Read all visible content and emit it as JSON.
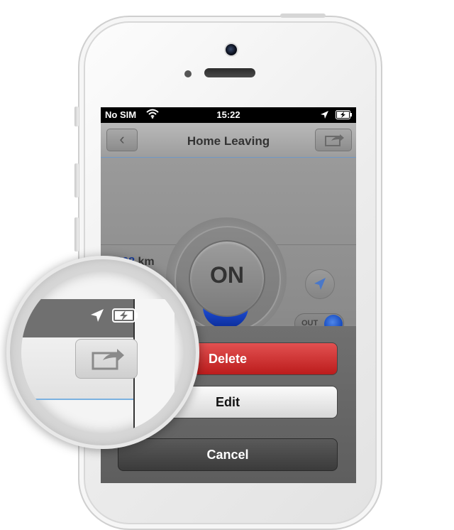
{
  "status_bar": {
    "carrier": "No SIM",
    "time": "15:22",
    "wifi_icon": "wifi-icon",
    "location_icon": "location-arrow-icon",
    "battery_icon": "battery-charging-icon"
  },
  "nav": {
    "title": "Home Leaving",
    "back_icon": "chevron-left-icon",
    "share_icon": "share-icon"
  },
  "main": {
    "distance_value": "7 508",
    "distance_unit": "km",
    "dial_label": "ON",
    "dial_level": 0.2,
    "navigate_icon": "navigation-arrow-icon",
    "toggle_label": "OUT",
    "toggle_state": "on"
  },
  "action_sheet": {
    "delete_label": "Delete",
    "edit_label": "Edit",
    "cancel_label": "Cancel"
  },
  "colors": {
    "accent_blue": "#1a4fc2",
    "delete_red": "#c92626",
    "link_blue": "#1b3f9b"
  }
}
